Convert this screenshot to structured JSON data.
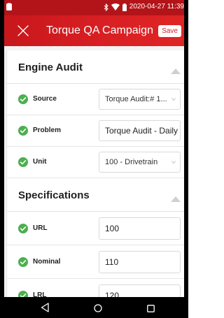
{
  "status_bar": {
    "datetime": "2020-04-27 11:39",
    "icons": [
      "notification-icon",
      "bluetooth-icon",
      "wifi-icon",
      "battery-icon"
    ]
  },
  "app_bar": {
    "title": "Torque QA Campaign",
    "close_icon": "close-icon",
    "save_label": "Save"
  },
  "sections": [
    {
      "title": "Engine Audit",
      "rows": [
        {
          "label": "Source",
          "value": "Torque Audit:# 1...",
          "type": "select"
        },
        {
          "label": "Problem",
          "value": "Torque Audit - Daily",
          "type": "text"
        },
        {
          "label": "Unit",
          "value": "100 - Drivetrain",
          "type": "select"
        }
      ]
    },
    {
      "title": "Specifications",
      "rows": [
        {
          "label": "URL",
          "value": "100",
          "type": "text"
        },
        {
          "label": "Nominal",
          "value": "110",
          "type": "text"
        },
        {
          "label": "LRL",
          "value": "120",
          "type": "text"
        }
      ]
    }
  ],
  "colors": {
    "primary": "#d81f23",
    "check": "#4caf50",
    "background": "#f4f4f4"
  },
  "nav_bar": {
    "icons": [
      "back-icon",
      "home-icon",
      "recent-apps-icon"
    ]
  }
}
